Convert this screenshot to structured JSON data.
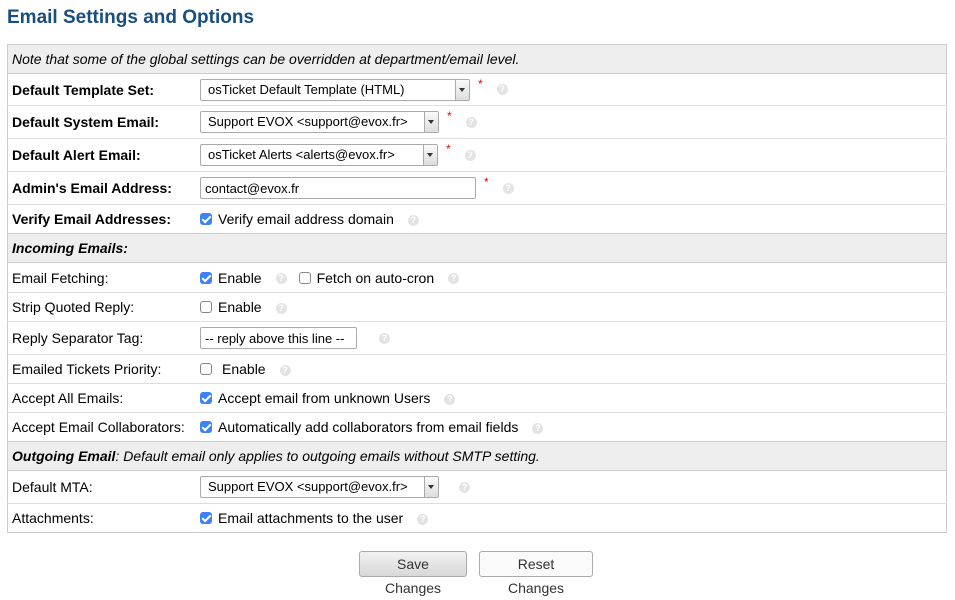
{
  "page_title": "Email Settings and Options",
  "note": "Note that some of the global settings can be overridden at department/email level.",
  "required_mark": "*",
  "help_glyph": "?",
  "rows": {
    "default_template_set": {
      "label": "Default Template Set:",
      "value": "osTicket Default Template (HTML)"
    },
    "default_system_email": {
      "label": "Default System Email:",
      "value": "Support EVOX <support@evox.fr>"
    },
    "default_alert_email": {
      "label": "Default Alert Email:",
      "value": "osTicket Alerts <alerts@evox.fr>"
    },
    "admin_email": {
      "label": "Admin's Email Address:",
      "value": "contact@evox.fr"
    },
    "verify_email": {
      "label": "Verify Email Addresses:",
      "option": "Verify email address domain",
      "checked": true
    }
  },
  "incoming": {
    "title": "Incoming Emails:",
    "email_fetching": {
      "label": "Email Fetching:",
      "option1": "Enable",
      "option1_checked": true,
      "option2": "Fetch on auto-cron",
      "option2_checked": false
    },
    "strip_quoted": {
      "label": "Strip Quoted Reply:",
      "option": "Enable",
      "checked": false
    },
    "reply_separator": {
      "label": "Reply Separator Tag:",
      "value": "-- reply above this line --"
    },
    "emailed_priority": {
      "label": "Emailed Tickets Priority:",
      "option": "Enable",
      "checked": false
    },
    "accept_all": {
      "label": "Accept All Emails:",
      "option": "Accept email from unknown Users",
      "checked": true
    },
    "accept_collab": {
      "label": "Accept Email Collaborators:",
      "option": "Automatically add collaborators from email fields",
      "checked": true
    }
  },
  "outgoing": {
    "title": "Outgoing Email",
    "note": ": Default email only applies to outgoing emails without SMTP setting.",
    "default_mta": {
      "label": "Default MTA:",
      "value": "Support EVOX <support@evox.fr>"
    },
    "attachments": {
      "label": "Attachments:",
      "option": "Email attachments to the user",
      "checked": true
    }
  },
  "buttons": {
    "save": "Save Changes",
    "reset": "Reset Changes"
  },
  "colors": {
    "title": "#184E81",
    "section_bg": "#EEEEEE",
    "checkbox": "#3B82F6",
    "required": "#EE0000"
  }
}
